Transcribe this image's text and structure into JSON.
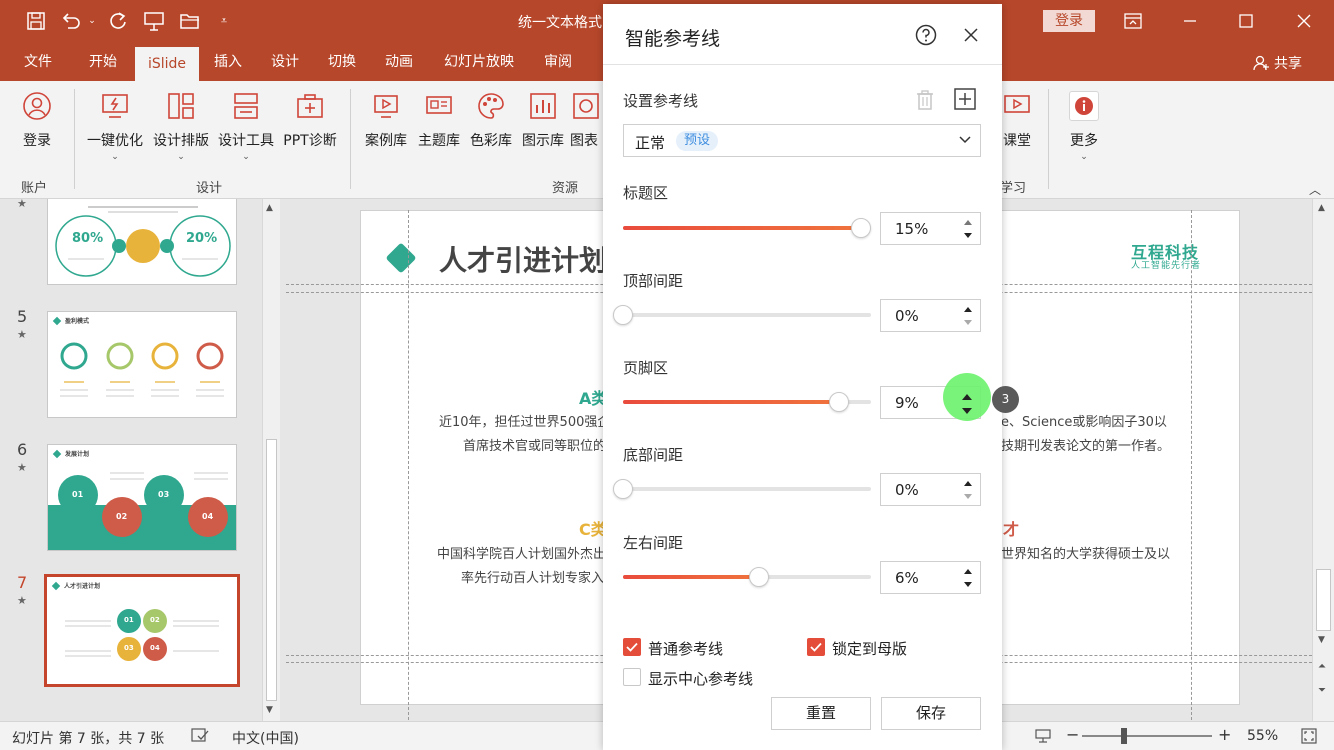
{
  "window": {
    "title": "统一文本格式",
    "login": "登录"
  },
  "tabs": [
    "文件",
    "开始",
    "iSlide",
    "插入",
    "设计",
    "切换",
    "动画",
    "幻灯片放映",
    "审阅"
  ],
  "share_label": "共享",
  "ribbon": {
    "account": {
      "login": "登录",
      "group": "账户"
    },
    "design_buttons": [
      "一键优化",
      "设计排版",
      "设计工具",
      "PPT诊断"
    ],
    "design_group": "设计",
    "resource_buttons": [
      "案例库",
      "主题库",
      "色彩库",
      "图示库",
      "图表"
    ],
    "resource_group": "资源",
    "classroom": "课堂",
    "study_group": "学习",
    "more": "更多"
  },
  "slides_panel": {
    "s4": {
      "p1": "80%",
      "p2": "20%"
    },
    "s5": {
      "num": "5",
      "title": "盈利模式"
    },
    "s6": {
      "num": "6",
      "title": "发展计划",
      "n": [
        "01",
        "02",
        "03",
        "04"
      ]
    },
    "s7": {
      "num": "7",
      "title": "人才引进计划",
      "n": [
        "01",
        "02",
        "03",
        "04"
      ]
    }
  },
  "slide": {
    "title": "人才引进计划",
    "brand": "互程科技",
    "brand_sub": "人工智能先行者",
    "a_head": "A类",
    "a_line1": "近10年，担任过世界500强企",
    "a_line2": "首席技术官或同等职位的",
    "right_line1": "e、Science或影响因子30以",
    "right_line2": "技期刊发表论文的第一作者。",
    "c_head": "C类",
    "c_line1": "中国科学院百人计划国外杰出",
    "c_line2": "率先行动百人计划专家入",
    "d_head": "才",
    "d_line1": "世界知名的大学获得硕士及以"
  },
  "dialog": {
    "title": "智能参考线",
    "set_guides": "设置参考线",
    "preset_name": "正常",
    "preset_tag": "预设",
    "title_area": {
      "label": "标题区",
      "value": "15%",
      "level": 0.96
    },
    "top_margin": {
      "label": "顶部间距",
      "value": "0%",
      "level": 0.0
    },
    "footer_area": {
      "label": "页脚区",
      "value": "9%",
      "level": 0.87
    },
    "bottom_margin": {
      "label": "底部间距",
      "value": "0%",
      "level": 0.0
    },
    "side_margin": {
      "label": "左右间距",
      "value": "6%",
      "level": 0.55
    },
    "normal_guides": "普通参考线",
    "lock_master": "锁定到母版",
    "center_guides": "显示中心参考线",
    "reset": "重置",
    "save": "保存",
    "badge": "3"
  },
  "status": {
    "slide_info": "幻灯片 第 7 张，共 7 张",
    "language": "中文(中国)",
    "zoom": "55%"
  },
  "colors": {
    "brand": "#b7472a",
    "accent": "#e34d3a",
    "teal": "#2fa88f",
    "yellow": "#e8b33a",
    "red": "#cf5b49"
  }
}
